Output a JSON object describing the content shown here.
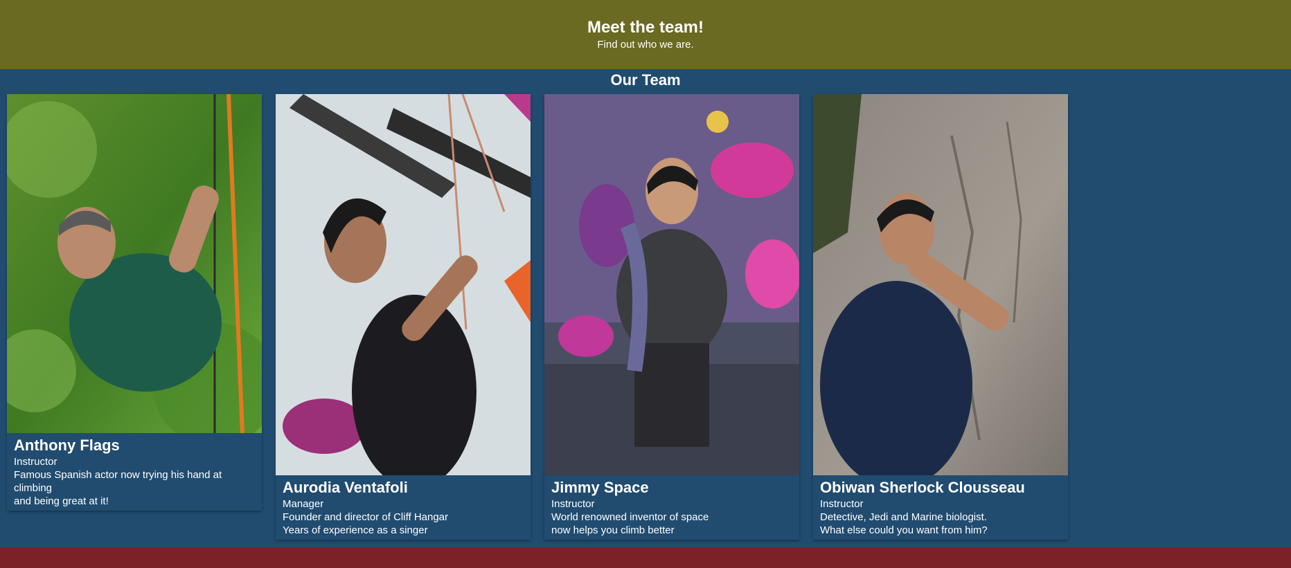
{
  "hero": {
    "title": "Meet the team!",
    "subtitle": "Find out who we are."
  },
  "team": {
    "heading": "Our Team",
    "members": [
      {
        "name": "Anthony Flags",
        "role": "Instructor",
        "bio": [
          "Famous Spanish actor now trying his hand at climbing",
          "and being great at it!"
        ]
      },
      {
        "name": "Aurodia Ventafoli",
        "role": "Manager",
        "bio": [
          "Founder and director of Cliff Hangar",
          "Years of experience as a singer"
        ]
      },
      {
        "name": "Jimmy Space",
        "role": "Instructor",
        "bio": [
          "World renowned inventor of space",
          "now helps you climb better"
        ]
      },
      {
        "name": "Obiwan Sherlock Clousseau",
        "role": "Instructor",
        "bio": [
          "Detective, Jedi and Marine biologist.",
          "What else could you want from him?"
        ]
      }
    ]
  },
  "colors": {
    "hero_bg": "#6a6a22",
    "section_bg": "#214c70",
    "footer_bg": "#7a2228"
  }
}
